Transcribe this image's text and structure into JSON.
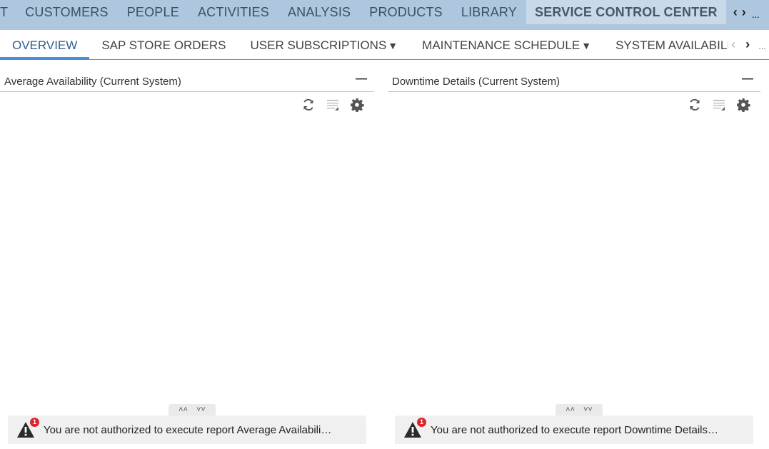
{
  "topnav": {
    "items": [
      "T",
      "CUSTOMERS",
      "PEOPLE",
      "ACTIVITIES",
      "ANALYSIS",
      "PRODUCTS",
      "LIBRARY"
    ],
    "active": "SERVICE CONTROL CENTER",
    "prev_arrow": "‹",
    "next_arrow": "›",
    "more": "…"
  },
  "subtabs": {
    "items": [
      {
        "label": "OVERVIEW"
      },
      {
        "label": "SAP STORE ORDERS"
      },
      {
        "label": "USER SUBSCRIPTIONS",
        "caret": "▼"
      },
      {
        "label": "MAINTENANCE SCHEDULE",
        "caret": "▼"
      },
      {
        "label": "SYSTEM AVAILABILIT"
      }
    ],
    "prev_arrow": "‹",
    "next_arrow": "›",
    "more": "…"
  },
  "panels": {
    "left": {
      "title": "Average Availability (Current System)",
      "minimize": "—",
      "message": "You are not authorized to execute report Average Availabili…",
      "badge": "1"
    },
    "right": {
      "title": "Downtime Details (Current System)",
      "minimize": "—",
      "message": "You are not authorized to execute report Downtime Details…",
      "badge": "1"
    }
  },
  "collapse": {
    "up": "˄˄",
    "down": "˅˅"
  },
  "colors": {
    "topnav_bg": "#aec6de",
    "active_tab_bg": "#c8d9e9",
    "active_subtab_underline": "#4a90d9",
    "badge": "#d9262c"
  },
  "icons": {
    "refresh": "refresh-icon",
    "table": "table-icon",
    "settings": "gear-icon",
    "warning": "warning-icon"
  }
}
